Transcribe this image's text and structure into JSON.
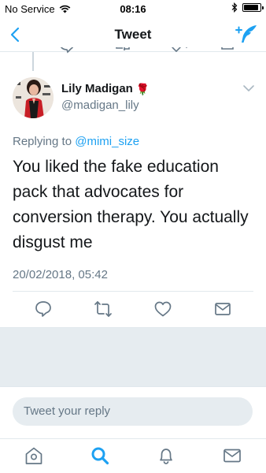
{
  "status_bar": {
    "carrier": "No Service",
    "time": "08:16",
    "battery_level": 0.9
  },
  "nav": {
    "title": "Tweet",
    "back_icon": "chevron-left-icon",
    "compose_icon": "compose-tweet-icon"
  },
  "tweet": {
    "author_name": "Lily Madigan",
    "author_emoji": "🌹",
    "author_handle": "@madigan_lily",
    "replying_prefix": "Replying to",
    "replying_to": "@mimi_size",
    "text": "You liked the fake education pack that advocates for conversion therapy. You actually disgust me",
    "timestamp": "20/02/2018, 05:42"
  },
  "reply": {
    "placeholder": "Tweet your reply"
  },
  "colors": {
    "accent": "#1da1f2",
    "secondary_text": "#657786",
    "icon_gray": "#657786",
    "divider": "#e1e8ed",
    "gray_background": "#e6ecf0"
  }
}
